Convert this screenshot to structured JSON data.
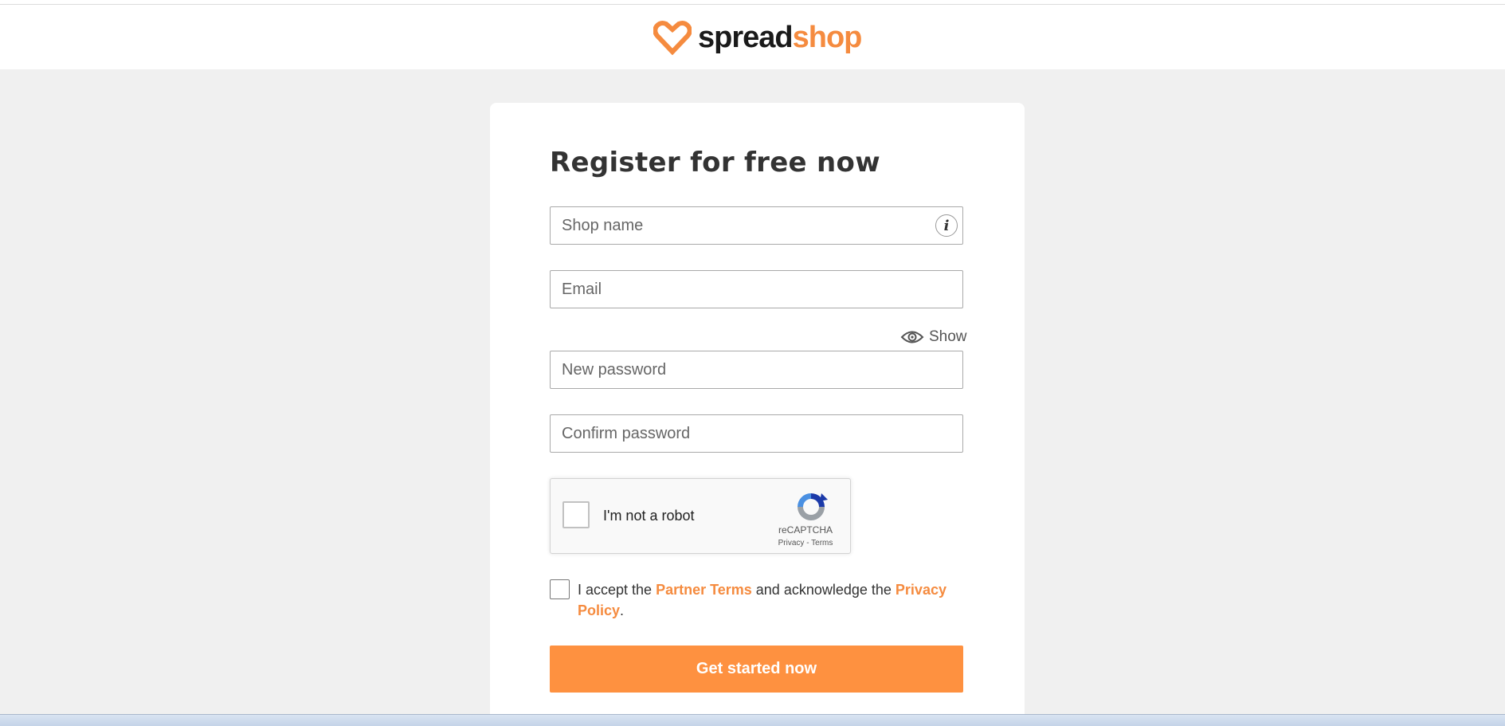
{
  "brand": {
    "name_part1": "spread",
    "name_part2": "shop",
    "accent": "#f58b3f",
    "icon": "heart-icon"
  },
  "form": {
    "title": "Register for free now",
    "shop_name_placeholder": "Shop name",
    "email_placeholder": "Email",
    "show_label": "Show",
    "new_password_placeholder": "New password",
    "confirm_password_placeholder": "Confirm password"
  },
  "recaptcha": {
    "label": "I'm not a robot",
    "brand": "reCAPTCHA",
    "privacy": "Privacy",
    "separator": " - ",
    "terms": "Terms"
  },
  "terms": {
    "prefix": "I accept the ",
    "partner_terms": "Partner Terms",
    "middle": " and acknowledge the ",
    "privacy_policy": "Privacy Policy",
    "suffix": "."
  },
  "cta": {
    "label": "Get started now",
    "color": "#fe9140"
  }
}
